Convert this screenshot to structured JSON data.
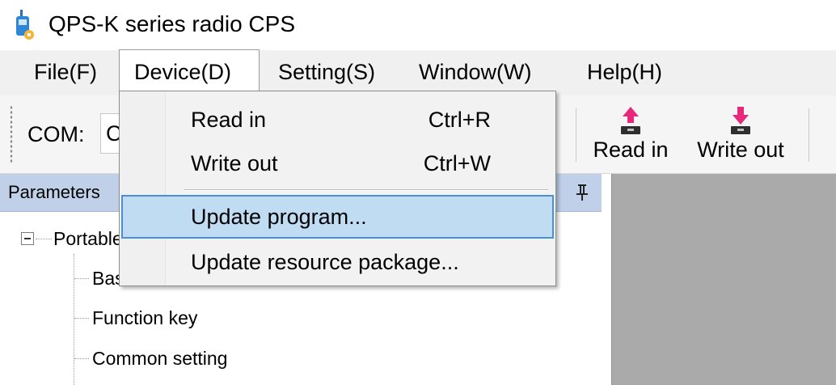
{
  "window": {
    "title": "QPS-K series radio CPS",
    "icon": "radio-icon"
  },
  "menubar": {
    "items": [
      {
        "label": "File(F)"
      },
      {
        "label": "Device(D)",
        "open": true
      },
      {
        "label": "Setting(S)"
      },
      {
        "label": "Window(W)"
      },
      {
        "label": "Help(H)"
      }
    ]
  },
  "toolbar": {
    "com_label": "COM:",
    "com_value": "C",
    "read_in_label": "Read in",
    "write_out_label": "Write out",
    "icons": {
      "read_in": "upload-arrow-icon",
      "write_out": "download-arrow-icon"
    },
    "arrow_color": "#e8287a"
  },
  "panel": {
    "title": "Parameters",
    "tree": {
      "root": "Portable",
      "children": [
        "Basic",
        "Function key",
        "Common setting"
      ]
    }
  },
  "device_menu": {
    "items": [
      {
        "label": "Read in",
        "shortcut": "Ctrl+R"
      },
      {
        "label": "Write out",
        "shortcut": "Ctrl+W"
      },
      {
        "label": "Update program...",
        "highlighted": true
      },
      {
        "label": "Update resource package..."
      }
    ]
  },
  "colors": {
    "highlight_fill": "#bfdcf3",
    "highlight_border": "#4a90d9",
    "panel_header": "#bfd0e8",
    "workspace": "#aaaaaa"
  }
}
